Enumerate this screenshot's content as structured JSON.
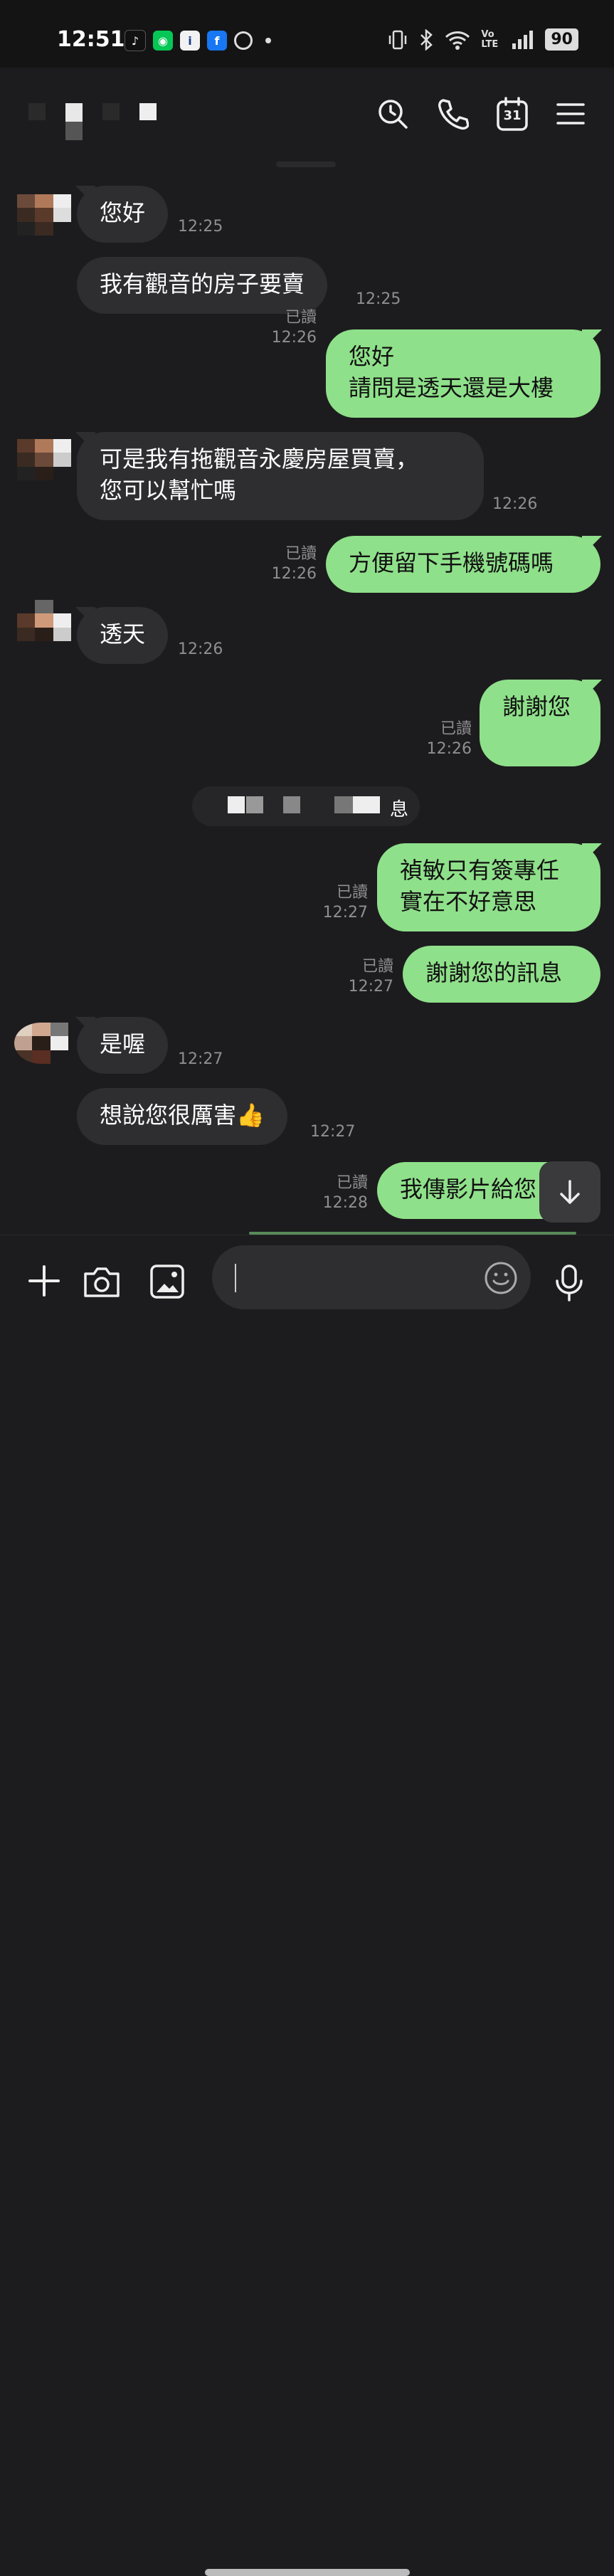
{
  "status_bar": {
    "time": "12:51",
    "battery": "90",
    "network_label": "Vo LTE"
  },
  "header": {
    "calendar_day": "31"
  },
  "messages": [
    {
      "side": "in",
      "text": "您好",
      "time": "12:25"
    },
    {
      "side": "in",
      "text": "我有觀音的房子要賣",
      "time": "12:25"
    },
    {
      "side": "out",
      "text": "您好\n請問是透天還是大樓",
      "read": "已讀",
      "time": "12:26"
    },
    {
      "side": "in",
      "text": "可是我有拖觀音永慶房屋買賣，\n您可以幫忙嗎",
      "time": "12:26"
    },
    {
      "side": "out",
      "text": "方便留下手機號碼嗎",
      "read": "已讀",
      "time": "12:26"
    },
    {
      "side": "in",
      "text": "透天",
      "time": "12:26"
    },
    {
      "side": "out",
      "text": "謝謝您",
      "read": "已讀",
      "time": "12:26"
    },
    {
      "side": "out",
      "text": "禎敏只有簽專任\n實在不好意思",
      "read": "已讀",
      "time": "12:27"
    },
    {
      "side": "out",
      "text": "謝謝您的訊息",
      "read": "已讀",
      "time": "12:27"
    },
    {
      "side": "in",
      "text": "是喔",
      "time": "12:27"
    },
    {
      "side": "in",
      "text": "想說您很厲害👍",
      "time": "12:27"
    },
    {
      "side": "out",
      "text": "我傳影片給您",
      "read": "已讀",
      "time": "12:28"
    }
  ],
  "notice": {
    "text_suffix": "息"
  },
  "colors": {
    "outgoing_bubble": "#8fe08a",
    "incoming_bubble": "#2e2e30",
    "background": "#1c1c1e"
  }
}
